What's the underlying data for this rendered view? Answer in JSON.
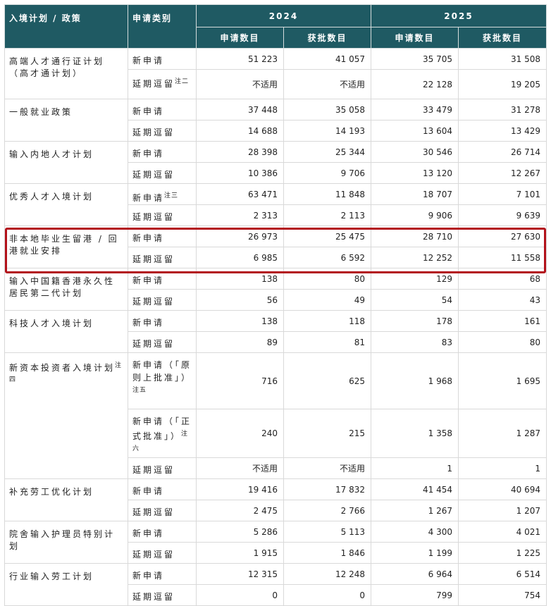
{
  "header": {
    "plan": "入境计划 / 政策",
    "category": "申请类别",
    "year_2024": "2024",
    "year_2025": "2025",
    "applications": "申请数目",
    "approved": "获批数目"
  },
  "rows": [
    {
      "plan": "高端人才通行证计划（高才通计划）",
      "note": "",
      "cat": "新申请",
      "cat_note": "",
      "v": [
        "51 223",
        "41 057",
        "35 705",
        "31 508"
      ]
    },
    {
      "cat": "延期逗留",
      "cat_note": "注二",
      "v": [
        "不适用",
        "不适用",
        "22 128",
        "19 205"
      ]
    },
    {
      "plan": "一般就业政策",
      "note": "",
      "cat": "新申请",
      "cat_note": "",
      "v": [
        "37 448",
        "35 058",
        "33 479",
        "31 278"
      ]
    },
    {
      "cat": "延期逗留",
      "cat_note": "",
      "v": [
        "14 688",
        "14 193",
        "13 604",
        "13 429"
      ]
    },
    {
      "plan": "输入内地人才计划",
      "note": "",
      "cat": "新申请",
      "cat_note": "",
      "v": [
        "28 398",
        "25 344",
        "30 546",
        "26 714"
      ]
    },
    {
      "cat": "延期逗留",
      "cat_note": "",
      "v": [
        "10 386",
        "9 706",
        "13 120",
        "12 267"
      ]
    },
    {
      "plan": "优秀人才入境计划",
      "note": "",
      "cat": "新申请",
      "cat_note": "注三",
      "v": [
        "63 471",
        "11 848",
        "18 707",
        "7 101"
      ]
    },
    {
      "cat": "延期逗留",
      "cat_note": "",
      "v": [
        "2 313",
        "2 113",
        "9 906",
        "9 639"
      ]
    },
    {
      "plan": "非本地毕业生留港 / 回港就业安排",
      "note": "",
      "cat": "新申请",
      "cat_note": "",
      "v": [
        "26 973",
        "25 475",
        "28 710",
        "27 630"
      ]
    },
    {
      "cat": "延期逗留",
      "cat_note": "",
      "v": [
        "6 985",
        "6 592",
        "12 252",
        "11 558"
      ]
    },
    {
      "plan": "输入中国籍香港永久性居民第二代计划",
      "note": "",
      "cat": "新申请",
      "cat_note": "",
      "v": [
        "138",
        "80",
        "129",
        "68"
      ]
    },
    {
      "cat": "延期逗留",
      "cat_note": "",
      "v": [
        "56",
        "49",
        "54",
        "43"
      ]
    },
    {
      "plan": "科技人才入境计划",
      "note": "",
      "cat": "新申请",
      "cat_note": "",
      "v": [
        "138",
        "118",
        "178",
        "161"
      ]
    },
    {
      "cat": "延期逗留",
      "cat_note": "",
      "v": [
        "89",
        "81",
        "83",
        "80"
      ]
    },
    {
      "plan": "新资本投资者入境计划",
      "note": "注四",
      "cat": "新申请（「原则上批准」）",
      "cat_note": "注五",
      "v": [
        "716",
        "625",
        "1 968",
        "1 695"
      ]
    },
    {
      "cat": "新申请（「正式批准」）",
      "cat_note": "注六",
      "v": [
        "240",
        "215",
        "1 358",
        "1 287"
      ]
    },
    {
      "cat": "延期逗留",
      "cat_note": "",
      "v": [
        "不适用",
        "不适用",
        "1",
        "1"
      ]
    },
    {
      "plan": "补充劳工优化计划",
      "note": "",
      "cat": "新申请",
      "cat_note": "",
      "v": [
        "19 416",
        "17 832",
        "41 454",
        "40 694"
      ]
    },
    {
      "cat": "延期逗留",
      "cat_note": "",
      "v": [
        "2 475",
        "2 766",
        "1 267",
        "1 207"
      ]
    },
    {
      "plan": "院舍输入护理员特别计划",
      "note": "",
      "cat": "新申请",
      "cat_note": "",
      "v": [
        "5 286",
        "5 113",
        "4 300",
        "4 021"
      ]
    },
    {
      "cat": "延期逗留",
      "cat_note": "",
      "v": [
        "1 915",
        "1 846",
        "1 199",
        "1 225"
      ]
    },
    {
      "plan": "行业输入劳工计划",
      "note": "",
      "cat": "新申请",
      "cat_note": "",
      "v": [
        "12 315",
        "12 248",
        "6 964",
        "6 514"
      ]
    },
    {
      "cat": "延期逗留",
      "cat_note": "",
      "v": [
        "0",
        "0",
        "799",
        "754"
      ]
    }
  ],
  "highlight_color": "#b3121b",
  "header_color": "#1f5a63"
}
